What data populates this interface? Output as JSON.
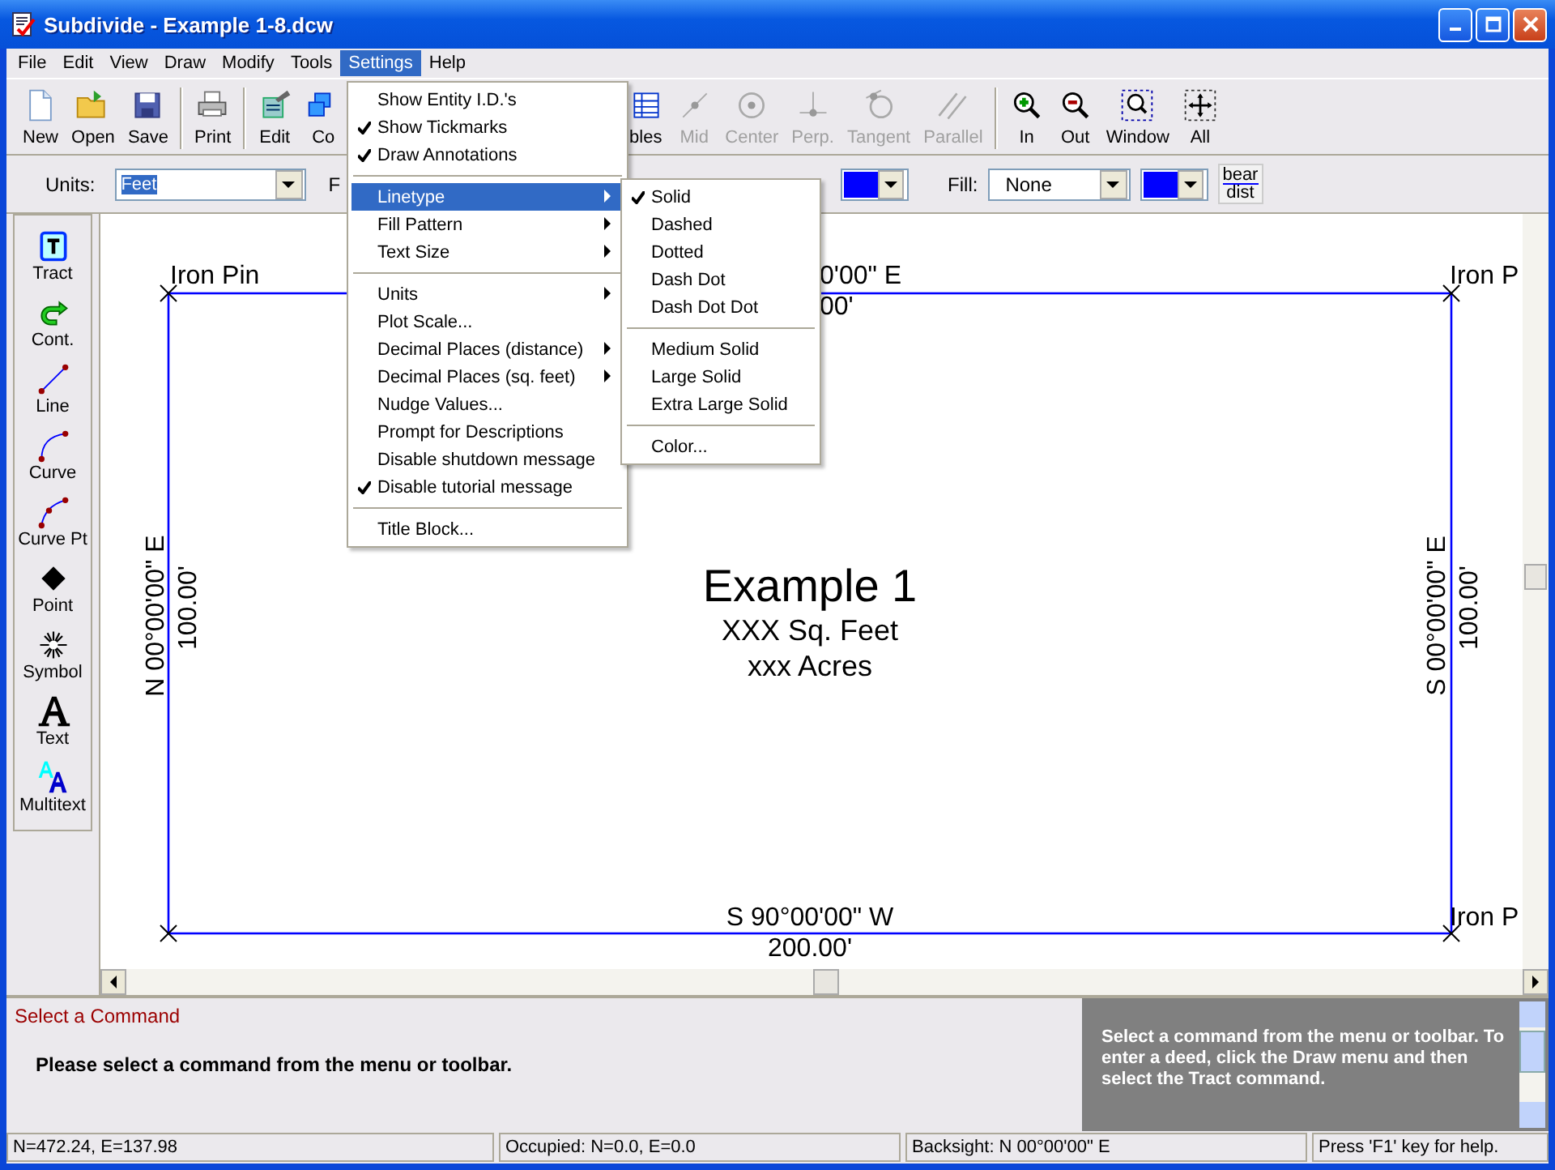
{
  "window": {
    "title": "Subdivide - Example 1-8.dcw"
  },
  "menu_bar": [
    {
      "label": "File",
      "selected": false
    },
    {
      "label": "Edit",
      "selected": false
    },
    {
      "label": "View",
      "selected": false
    },
    {
      "label": "Draw",
      "selected": false
    },
    {
      "label": "Modify",
      "selected": false
    },
    {
      "label": "Tools",
      "selected": false
    },
    {
      "label": "Settings",
      "selected": true
    },
    {
      "label": "Help",
      "selected": false
    }
  ],
  "toolbar": [
    {
      "kind": "button",
      "label": "New",
      "disabled": false
    },
    {
      "kind": "button",
      "label": "Open",
      "disabled": false
    },
    {
      "kind": "button",
      "label": "Save",
      "disabled": false
    },
    {
      "kind": "separator"
    },
    {
      "kind": "button",
      "label": "Print",
      "disabled": false
    },
    {
      "kind": "separator"
    },
    {
      "kind": "button",
      "label": "Edit",
      "disabled": false
    },
    {
      "kind": "button",
      "label": "Co",
      "disabled": false
    },
    {
      "kind": "gap"
    },
    {
      "kind": "button",
      "label": "bles",
      "disabled": false
    },
    {
      "kind": "button",
      "label": "Mid",
      "disabled": true
    },
    {
      "kind": "button",
      "label": "Center",
      "disabled": true
    },
    {
      "kind": "button",
      "label": "Perp.",
      "disabled": true
    },
    {
      "kind": "button",
      "label": "Tangent",
      "disabled": true
    },
    {
      "kind": "button",
      "label": "Parallel",
      "disabled": true
    },
    {
      "kind": "separator"
    },
    {
      "kind": "button",
      "label": "In",
      "disabled": false
    },
    {
      "kind": "button",
      "label": "Out",
      "disabled": false
    },
    {
      "kind": "button",
      "label": "Window",
      "disabled": false
    },
    {
      "kind": "button",
      "label": "All",
      "disabled": false
    }
  ],
  "format_bar": {
    "units_label": "Units:",
    "units_value": "Feet",
    "units_text_selected": true,
    "cut_label": "F",
    "fill_label": "Fill:",
    "fill_value": "None",
    "bear_dist": [
      "bear",
      "dist"
    ]
  },
  "settings_menu": [
    {
      "kind": "item",
      "label": "Show Entity I.D.'s",
      "checked": false,
      "submenu": false,
      "selected": false
    },
    {
      "kind": "item",
      "label": "Show Tickmarks",
      "checked": true,
      "submenu": false,
      "selected": false
    },
    {
      "kind": "item",
      "label": "Draw Annotations",
      "checked": true,
      "submenu": false,
      "selected": false
    },
    {
      "kind": "separator"
    },
    {
      "kind": "item",
      "label": "Linetype",
      "checked": false,
      "submenu": true,
      "selected": true
    },
    {
      "kind": "item",
      "label": "Fill Pattern",
      "checked": false,
      "submenu": true,
      "selected": false
    },
    {
      "kind": "item",
      "label": "Text Size",
      "checked": false,
      "submenu": true,
      "selected": false
    },
    {
      "kind": "separator"
    },
    {
      "kind": "item",
      "label": "Units",
      "checked": false,
      "submenu": true,
      "selected": false
    },
    {
      "kind": "item",
      "label": "Plot Scale...",
      "checked": false,
      "submenu": false,
      "selected": false
    },
    {
      "kind": "item",
      "label": "Decimal Places (distance)",
      "checked": false,
      "submenu": true,
      "selected": false
    },
    {
      "kind": "item",
      "label": "Decimal Places (sq. feet)",
      "checked": false,
      "submenu": true,
      "selected": false
    },
    {
      "kind": "item",
      "label": "Nudge Values...",
      "checked": false,
      "submenu": false,
      "selected": false
    },
    {
      "kind": "item",
      "label": "Prompt for Descriptions",
      "checked": false,
      "submenu": false,
      "selected": false
    },
    {
      "kind": "item",
      "label": "Disable shutdown message",
      "checked": false,
      "submenu": false,
      "selected": false
    },
    {
      "kind": "item",
      "label": "Disable tutorial message",
      "checked": true,
      "submenu": false,
      "selected": false
    },
    {
      "kind": "separator"
    },
    {
      "kind": "item",
      "label": "Title Block...",
      "checked": false,
      "submenu": false,
      "selected": false
    }
  ],
  "linetype_menu": [
    {
      "kind": "item",
      "label": "Solid",
      "checked": true
    },
    {
      "kind": "item",
      "label": "Dashed",
      "checked": false
    },
    {
      "kind": "item",
      "label": "Dotted",
      "checked": false
    },
    {
      "kind": "item",
      "label": "Dash Dot",
      "checked": false
    },
    {
      "kind": "item",
      "label": "Dash Dot Dot",
      "checked": false
    },
    {
      "kind": "separator"
    },
    {
      "kind": "item",
      "label": "Medium Solid",
      "checked": false
    },
    {
      "kind": "item",
      "label": "Large Solid",
      "checked": false
    },
    {
      "kind": "item",
      "label": "Extra Large Solid",
      "checked": false
    },
    {
      "kind": "separator"
    },
    {
      "kind": "item",
      "label": "Color...",
      "checked": false
    }
  ],
  "tool_palette": [
    "Tract",
    "Cont.",
    "Line",
    "Curve",
    "Curve Pt",
    "Point",
    "Symbol",
    "Text",
    "Multitext"
  ],
  "drawing": {
    "corner_top_left": "Iron Pin",
    "corner_top_right": "Iron P",
    "corner_bottom_right": "Iron P",
    "top_bearing": "0'00\" E",
    "top_distance": "00'",
    "left_bearing": "N 00°00'00\" E",
    "left_distance": "100.00'",
    "right_bearing": "S 00°00'00\" E",
    "right_distance": "100.00'",
    "bottom_bearing": "S 90°00'00\" W",
    "bottom_distance": "200.00'",
    "title": "Example 1",
    "area_feet": "XXX  Sq. Feet",
    "area_acres": "xxx  Acres"
  },
  "command_panel": {
    "heading": "Select a Command",
    "message": "Please select a command from the menu or toolbar.",
    "help": "Select a command from the menu or toolbar. To enter a deed, click the Draw menu and then select the Tract command."
  },
  "status_bar": [
    "N=472.24,  E=137.98",
    "Occupied:  N=0.0, E=0.0",
    "Backsight: N 00°00'00\" E",
    "Press 'F1' key  for help."
  ]
}
